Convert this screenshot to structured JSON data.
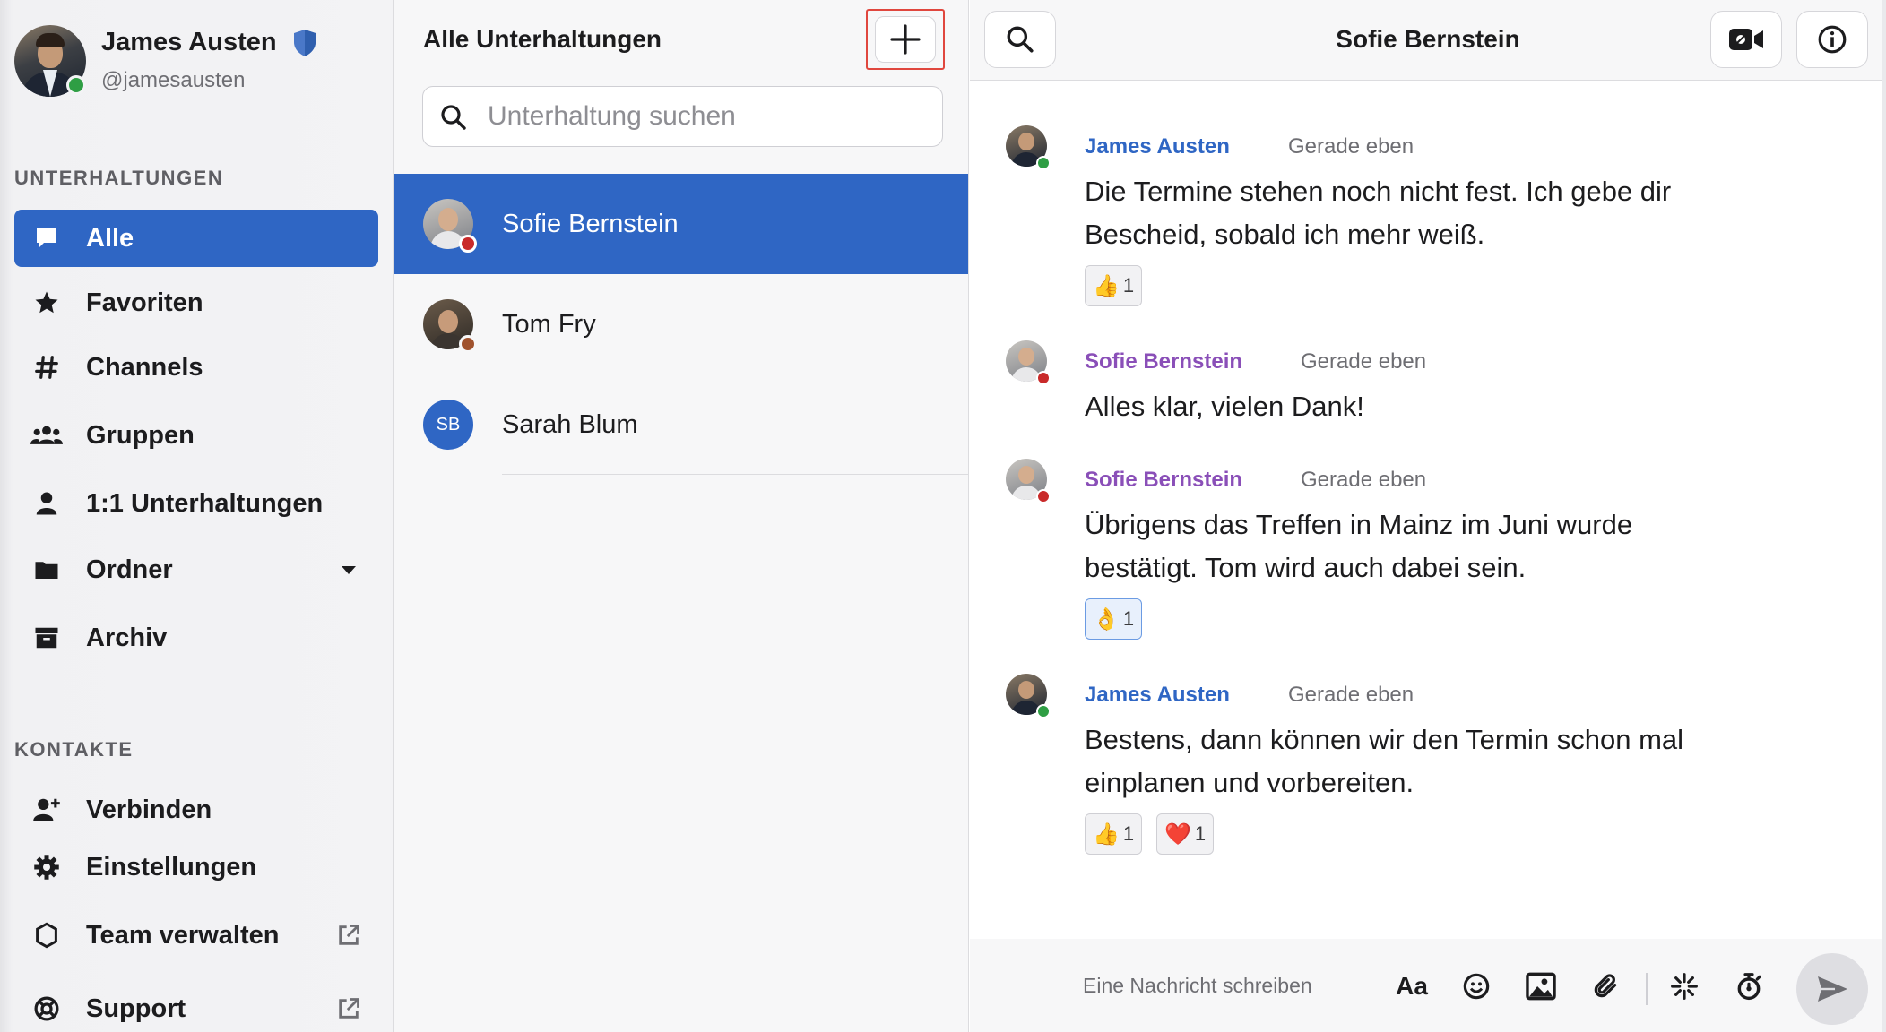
{
  "user": {
    "name": "James Austen",
    "handle": "@jamesausten",
    "status_color": "#2f9e44"
  },
  "sidebar": {
    "section_conversations": "UNTERHALTUNGEN",
    "section_contacts": "KONTAKTE",
    "items": [
      {
        "label": "Alle",
        "icon": "chat-bubble-icon",
        "active": true
      },
      {
        "label": "Favoriten",
        "icon": "star-icon"
      },
      {
        "label": "Channels",
        "icon": "hash-icon"
      },
      {
        "label": "Gruppen",
        "icon": "group-icon"
      },
      {
        "label": "1:1 Unterhaltungen",
        "icon": "person-icon"
      },
      {
        "label": "Ordner",
        "icon": "folder-icon",
        "trailing": "caret-down-icon"
      },
      {
        "label": "Archiv",
        "icon": "archive-icon"
      }
    ],
    "contacts": [
      {
        "label": "Verbinden",
        "icon": "add-person-icon"
      },
      {
        "label": "Einstellungen",
        "icon": "gear-icon"
      },
      {
        "label": "Team verwalten",
        "icon": "hexagon-icon",
        "trailing": "external-link-icon"
      },
      {
        "label": "Support",
        "icon": "lifebuoy-icon",
        "trailing": "external-link-icon"
      }
    ]
  },
  "conversations": {
    "title": "Alle Unterhaltungen",
    "search_placeholder": "Unterhaltung suchen",
    "items": [
      {
        "name": "Sofie Bernstein",
        "active": true,
        "status_color": "#c92a2a"
      },
      {
        "name": "Tom Fry",
        "status_color": "#a0522d"
      },
      {
        "name": "Sarah Blum",
        "initials": "SB"
      }
    ]
  },
  "chat": {
    "title": "Sofie Bernstein",
    "messages": [
      {
        "author": "James Austen",
        "author_color": "#2f66c4",
        "time": "Gerade eben",
        "lines": [
          "Die Termine stehen noch nicht fest. Ich gebe dir",
          "Bescheid, sobald ich mehr weiß."
        ],
        "reactions": [
          {
            "emoji": "👍",
            "count": "1"
          }
        ]
      },
      {
        "author": "Sofie Bernstein",
        "author_color": "#8a4fb8",
        "time": "Gerade eben",
        "lines": [
          "Alles klar, vielen Dank!"
        ],
        "reactions": []
      },
      {
        "author": "Sofie Bernstein",
        "author_color": "#8a4fb8",
        "time": "Gerade eben",
        "lines": [
          "Übrigens das Treffen in Mainz im Juni wurde",
          "bestätigt. Tom wird auch dabei sein."
        ],
        "reactions": [
          {
            "emoji": "👌",
            "count": "1",
            "mine": true
          }
        ]
      },
      {
        "author": "James Austen",
        "author_color": "#2f66c4",
        "time": "Gerade eben",
        "lines": [
          "Bestens, dann können wir den Termin schon mal",
          "einplanen und vorbereiten."
        ],
        "reactions": [
          {
            "emoji": "👍",
            "count": "1"
          },
          {
            "emoji": "❤️",
            "count": "1"
          }
        ]
      }
    ],
    "composer_placeholder": "Eine Nachricht schreiben",
    "format_label": "Aa"
  },
  "colors": {
    "accent": "#2f66c4",
    "online": "#2f9e44",
    "busy": "#c92a2a",
    "highlight_border": "#e0473e"
  }
}
